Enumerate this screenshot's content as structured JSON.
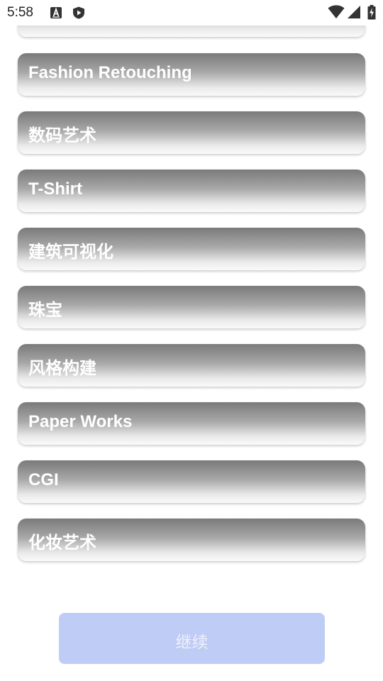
{
  "status_bar": {
    "time": "5:58",
    "left_icons": [
      "a-badge-icon",
      "shield-play-icon"
    ],
    "right_icons": [
      "wifi-icon",
      "signal-icon",
      "battery-icon"
    ]
  },
  "categories": [
    {
      "label": ""
    },
    {
      "label": "Fashion Retouching"
    },
    {
      "label": "数码艺术"
    },
    {
      "label": "T-Shirt"
    },
    {
      "label": "建筑可视化"
    },
    {
      "label": "珠宝"
    },
    {
      "label": "风格构建"
    },
    {
      "label": "Paper Works"
    },
    {
      "label": "CGI"
    },
    {
      "label": "化妆艺术"
    }
  ],
  "continue_button": {
    "label": "继续",
    "color": "#bfccf5"
  }
}
